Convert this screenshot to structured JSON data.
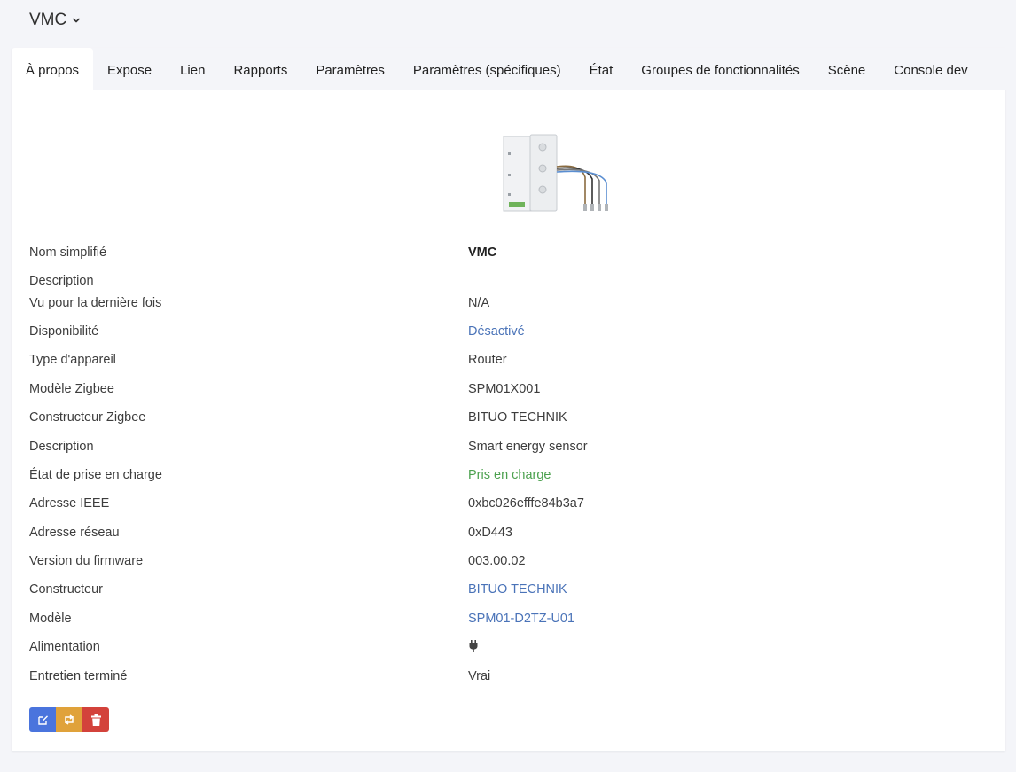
{
  "header": {
    "device_name": "VMC"
  },
  "tabs": [
    {
      "label": "À propos",
      "active": true
    },
    {
      "label": "Expose"
    },
    {
      "label": "Lien"
    },
    {
      "label": "Rapports"
    },
    {
      "label": "Paramètres"
    },
    {
      "label": "Paramètres (spécifiques)"
    },
    {
      "label": "État"
    },
    {
      "label": "Groupes de fonctionnalités"
    },
    {
      "label": "Scène"
    },
    {
      "label": "Console dev"
    }
  ],
  "details": [
    {
      "label": "Nom simplifié",
      "value": "VMC"
    },
    {
      "label": "Description",
      "value": ""
    },
    {
      "label": "Vu pour la dernière fois",
      "value": "N/A"
    },
    {
      "label": "Disponibilité",
      "value": "Désactivé"
    },
    {
      "label": "Type d'appareil",
      "value": "Router"
    },
    {
      "label": "Modèle Zigbee",
      "value": "SPM01X001"
    },
    {
      "label": "Constructeur Zigbee",
      "value": "BITUO TECHNIK"
    },
    {
      "label": "Description",
      "value": "Smart energy sensor"
    },
    {
      "label": "État de prise en charge",
      "value": "Pris en charge"
    },
    {
      "label": "Adresse IEEE",
      "value": "0xbc026efffe84b3a7"
    },
    {
      "label": "Adresse réseau",
      "value": "0xD443"
    },
    {
      "label": "Version du firmware",
      "value": "003.00.02"
    },
    {
      "label": "Constructeur",
      "value": "BITUO TECHNIK"
    },
    {
      "label": "Modèle",
      "value": "SPM01-D2TZ-U01"
    },
    {
      "label": "Alimentation",
      "value": "",
      "icon": "plug-icon"
    },
    {
      "label": "Entretien terminé",
      "value": "Vrai"
    }
  ],
  "colors": {
    "link": "#4a73b8",
    "success": "#4ca14f",
    "edit_button": "#4a74dd",
    "rename_button": "#e0a23a",
    "delete_button": "#d3423b"
  },
  "actions": {
    "icons": [
      "edit-icon",
      "rename-icon",
      "trash-icon"
    ]
  }
}
